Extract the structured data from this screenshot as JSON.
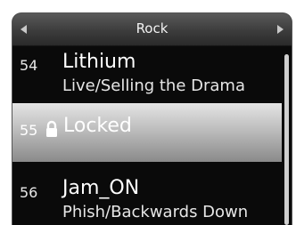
{
  "header": {
    "title": "Rock"
  },
  "list": {
    "items": [
      {
        "number": "54",
        "title": "Lithium",
        "subtitle": "Live/Selling the Drama"
      },
      {
        "number": "55",
        "title": "Locked",
        "locked": true
      },
      {
        "number": "56",
        "title": "Jam_ON",
        "subtitle": "Phish/Backwards Down"
      }
    ]
  },
  "icons": {
    "prev": "triangle-left-icon",
    "next": "triangle-right-icon",
    "lock": "padlock-icon"
  },
  "colors": {
    "background": "#0a0a0a",
    "selected_highlight": "#bdbdbd",
    "text": "#ffffff"
  }
}
